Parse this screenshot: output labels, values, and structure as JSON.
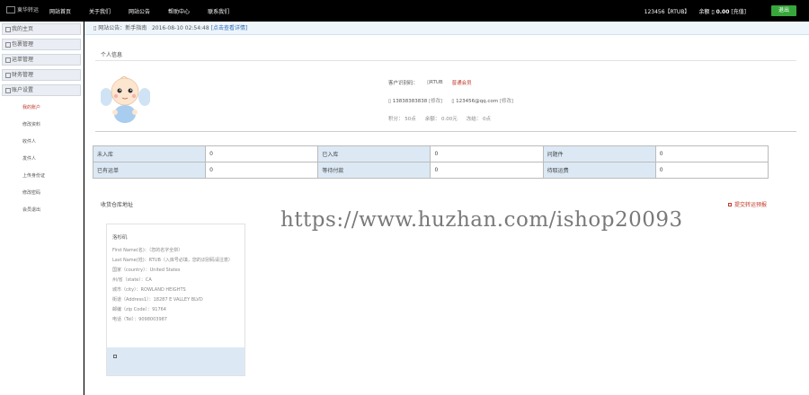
{
  "header": {
    "logo_text": "東华转运",
    "nav": [
      "网站首页",
      "关于我们",
      "网站公告",
      "帮助中心",
      "联系我们"
    ],
    "user_code": "123456【RTUB】",
    "balance_label": "余额",
    "balance_value": "0.00",
    "recharge": "[充值]",
    "logout": "退出"
  },
  "sidebar": {
    "menus": [
      "我的主页",
      "包裹管理",
      "运单管理",
      "财务管理",
      "账户设置"
    ],
    "items": [
      "我的账户",
      "修改资料",
      "收件人",
      "发件人",
      "上传身份证",
      "修改密码",
      "会员退出"
    ]
  },
  "notice": {
    "label": "网站公告：新手指南",
    "time": "2016-08-10 02:54:48",
    "more": "[点击查看详情]"
  },
  "profile": {
    "title": "个人信息",
    "customer_label": "客户识别码：",
    "customer_code": "RTUB",
    "level": "普通会员",
    "phone": "13838383838",
    "phone_edit": "[修改]",
    "email": "123456@qq.com",
    "email_edit": "[修改]",
    "points": "积分： 50点",
    "balance": "余额： 0.00元",
    "frozen": "冻结： 0点"
  },
  "stats": [
    [
      "未入库",
      "0",
      "已入库",
      "0",
      "问题件",
      "0"
    ],
    [
      "已有运单",
      "0",
      "等待付款",
      "0",
      "待取运费",
      "0"
    ]
  ],
  "watermark": "https://www.huzhan.com/ishop20093",
  "address": {
    "title": "收货仓库地址",
    "submit": "提交转运预报",
    "card_title": "洛杉矶",
    "lines": [
      "First Name(名)：（您的名字全拼）",
      "Last Name(姓)：RTUB（入库号必填，您的识别码请注意）",
      "国家（country）：United States",
      "州/省（state）：CA",
      "城市（city）：ROWLAND HEIGHTS",
      "街道（Address1）：18287 E VALLEY BLVD",
      "邮编（zip Code）：91764",
      "电话（Tel）：9098003987"
    ]
  }
}
